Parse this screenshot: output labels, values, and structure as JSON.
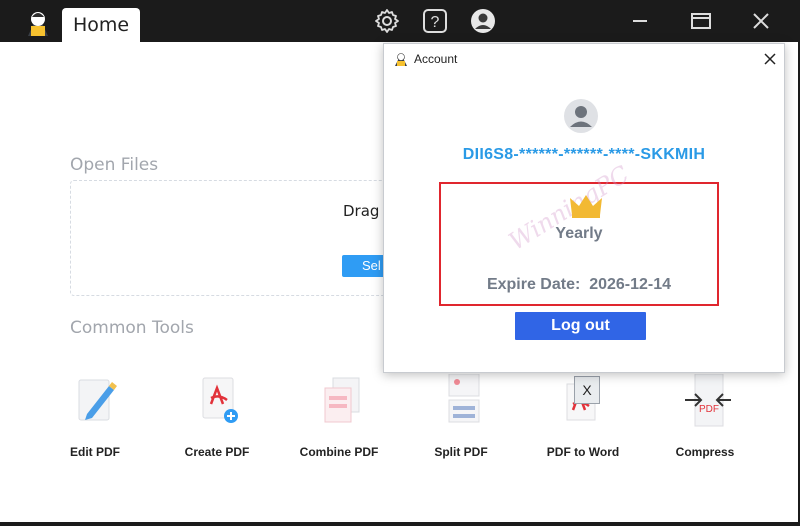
{
  "titlebar": {
    "tab_home": "Home",
    "icons": [
      "logo-icon",
      "settings-gear-icon",
      "help-icon",
      "user-icon",
      "minimize-icon",
      "maximize-icon",
      "close-icon"
    ]
  },
  "main": {
    "open_files_title": "Open Files",
    "drag_text": "Drag f",
    "select_label": "Sel",
    "common_tools_title": "Common Tools",
    "tools": [
      {
        "label": "Edit PDF",
        "icon": "edit-pdf-icon"
      },
      {
        "label": "Create PDF",
        "icon": "create-pdf-icon"
      },
      {
        "label": "Combine PDF",
        "icon": "combine-pdf-icon"
      },
      {
        "label": "Split PDF",
        "icon": "split-pdf-icon"
      },
      {
        "label": "PDF to Word",
        "icon": "pdf-to-word-icon"
      },
      {
        "label": "Compress",
        "icon": "compress-icon"
      }
    ],
    "x_badge": "X"
  },
  "account": {
    "title": "Account",
    "license_key": "DII6S8-******-******-****-SKKMIH",
    "plan": "Yearly",
    "expire_label": "Expire Date:",
    "expire_date": "2026-12-14",
    "logout_label": "Log out",
    "watermark": "WinningPC"
  },
  "colors": {
    "accent_blue": "#2a9ae6",
    "button_blue": "#3065e6",
    "highlight_red": "#e0262e",
    "crown_gold": "#f2b933"
  }
}
